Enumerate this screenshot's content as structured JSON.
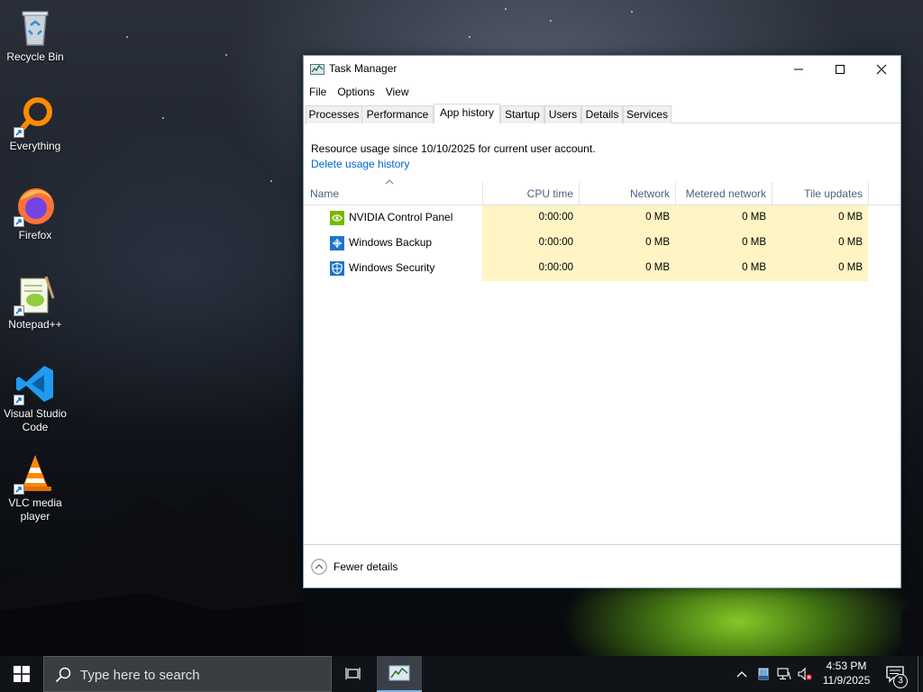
{
  "desktop": {
    "icons": [
      {
        "label": "Recycle Bin",
        "icon": "recycle-bin-icon"
      },
      {
        "label": "Everything",
        "icon": "everything-search-icon"
      },
      {
        "label": "Firefox",
        "icon": "firefox-icon"
      },
      {
        "label": "Notepad++",
        "icon": "notepad-plus-plus-icon"
      },
      {
        "label": "Visual Studio Code",
        "icon": "vscode-icon"
      },
      {
        "label": "VLC media player",
        "icon": "vlc-icon"
      }
    ]
  },
  "window": {
    "title": "Task Manager",
    "menu": [
      "File",
      "Options",
      "View"
    ],
    "tabs": [
      "Processes",
      "Performance",
      "App history",
      "Startup",
      "Users",
      "Details",
      "Services"
    ],
    "active_tab": "App history",
    "info_text": "Resource usage since 10/10/2025 for current user account.",
    "delete_link": "Delete usage history",
    "columns": [
      "Name",
      "CPU time",
      "Network",
      "Metered network",
      "Tile updates"
    ],
    "rows": [
      {
        "name": "NVIDIA Control Panel",
        "cpu": "0:00:00",
        "network": "0 MB",
        "metered": "0 MB",
        "tile": "0 MB",
        "icon": "nvidia-icon"
      },
      {
        "name": "Windows Backup",
        "cpu": "0:00:00",
        "network": "0 MB",
        "metered": "0 MB",
        "tile": "0 MB",
        "icon": "windows-backup-icon"
      },
      {
        "name": "Windows Security",
        "cpu": "0:00:00",
        "network": "0 MB",
        "metered": "0 MB",
        "tile": "0 MB",
        "icon": "windows-security-icon"
      }
    ],
    "footer_label": "Fewer details",
    "highlight_color": "#fff4c4"
  },
  "taskbar": {
    "search_placeholder": "Type here to search",
    "time": "4:53 PM",
    "date": "11/9/2025",
    "notification_count": "3"
  }
}
